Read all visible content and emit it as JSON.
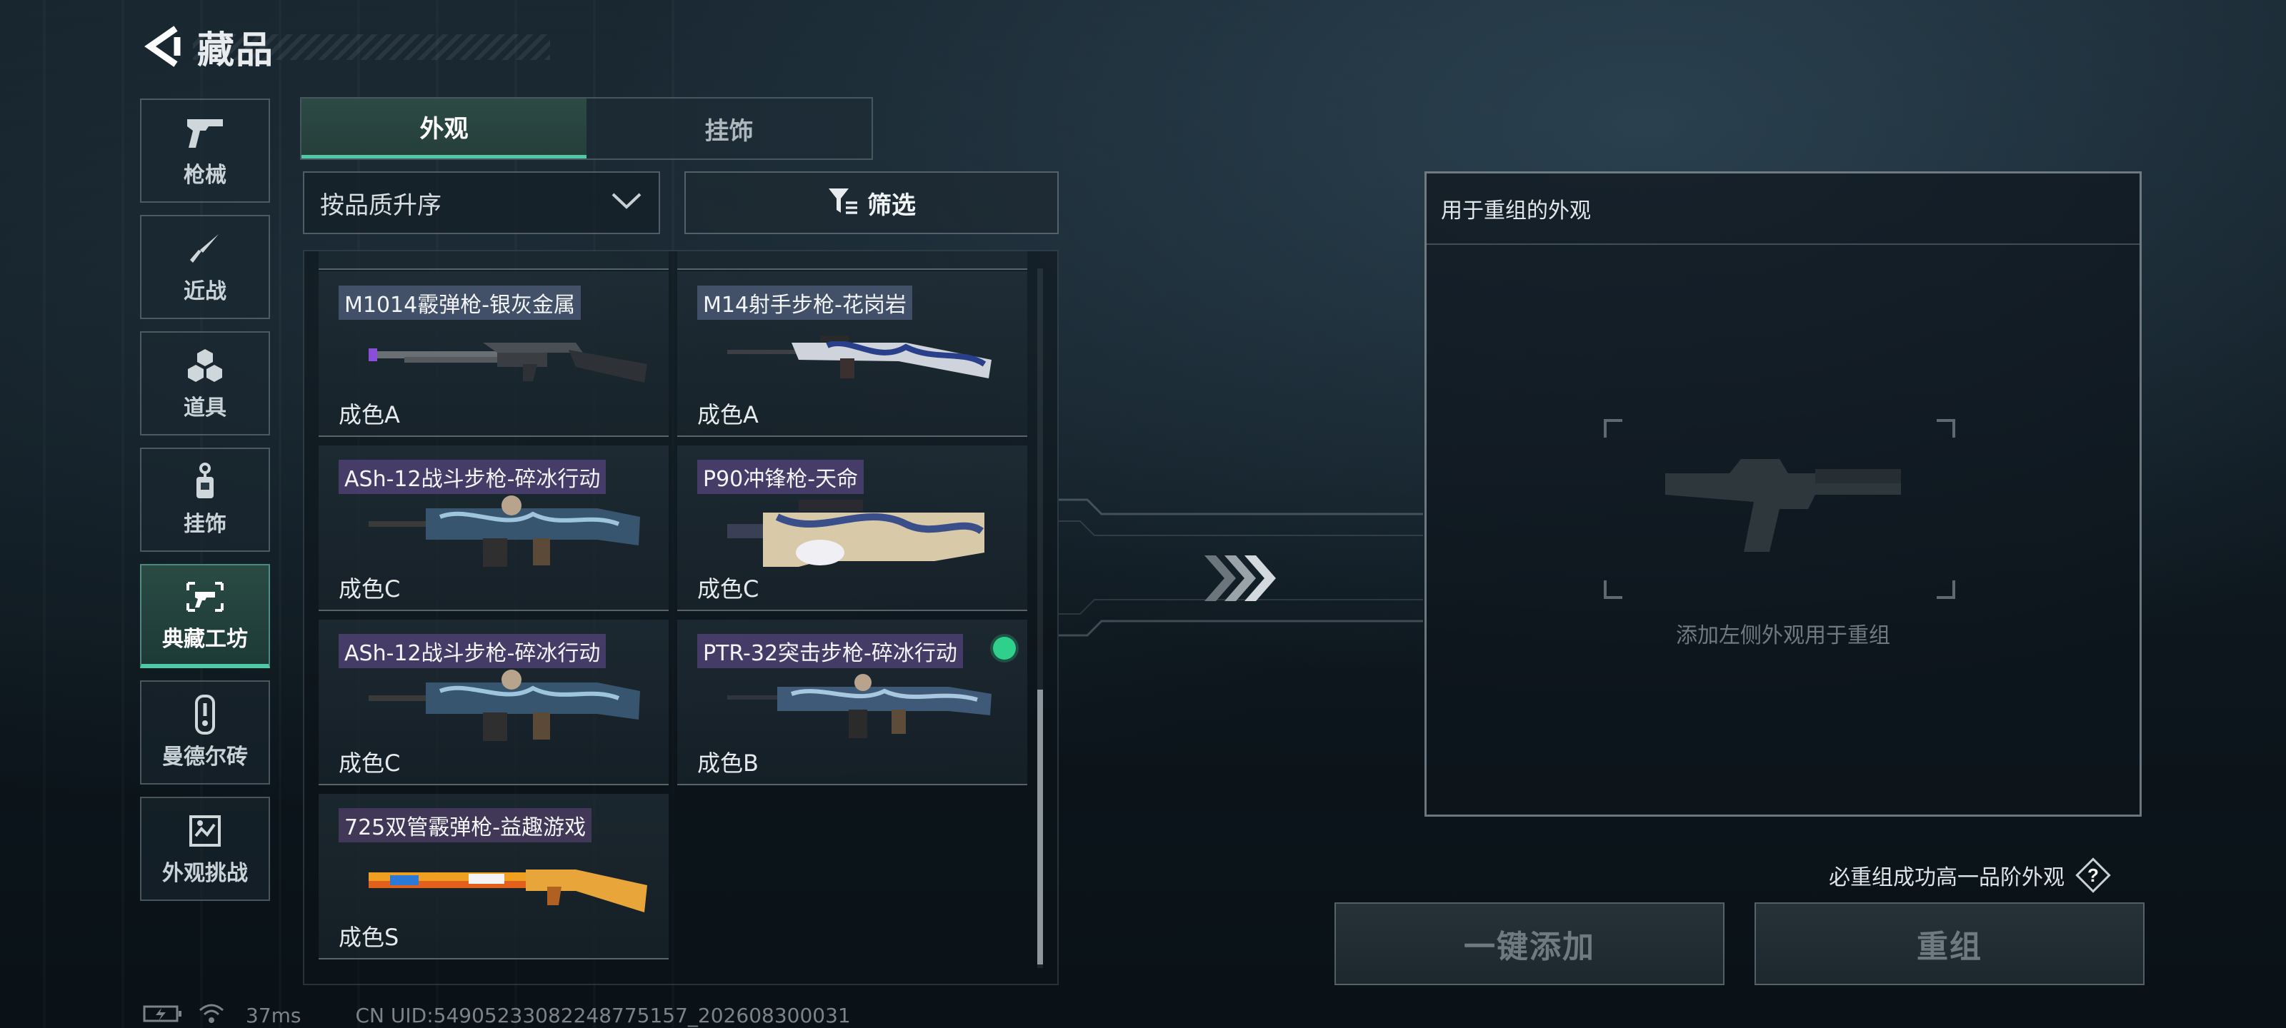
{
  "header": {
    "title": "藏品",
    "back_icon": "arrow-left-icon"
  },
  "sidenav": {
    "items": [
      {
        "label": "枪械",
        "icon": "pistol-icon",
        "active": false
      },
      {
        "label": "近战",
        "icon": "knife-icon",
        "active": false
      },
      {
        "label": "道具",
        "icon": "boxes-icon",
        "active": false
      },
      {
        "label": "挂饰",
        "icon": "charm-icon",
        "active": false
      },
      {
        "label": "典藏工坊",
        "icon": "workshop-icon",
        "active": true
      },
      {
        "label": "曼德尔砖",
        "icon": "brick-icon",
        "active": false
      },
      {
        "label": "外观挑战",
        "icon": "challenge-icon",
        "active": false
      }
    ]
  },
  "tabs": [
    {
      "label": "外观",
      "active": true
    },
    {
      "label": "挂饰",
      "active": false
    }
  ],
  "sort": {
    "label": "按品质升序",
    "icon": "chevron-down-icon"
  },
  "filter": {
    "label": "筛选",
    "icon": "filter-icon"
  },
  "grid": {
    "partial_label": "成色A",
    "items": [
      {
        "name": "M1014霰弹枪-银灰金属",
        "grade": "成色A",
        "selected": false,
        "tag": "blue"
      },
      {
        "name": "M14射手步枪-花岗岩",
        "grade": "成色A",
        "selected": false,
        "tag": "blue"
      },
      {
        "name": "ASh-12战斗步枪-碎冰行动",
        "grade": "成色C",
        "selected": false,
        "tag": "purple"
      },
      {
        "name": "P90冲锋枪-天命",
        "grade": "成色C",
        "selected": false,
        "tag": "purple"
      },
      {
        "name": "ASh-12战斗步枪-碎冰行动",
        "grade": "成色C",
        "selected": false,
        "tag": "purple"
      },
      {
        "name": "PTR-32突击步枪-碎冰行动",
        "grade": "成色B",
        "selected": true,
        "tag": "purple"
      },
      {
        "name": "725双管霰弹枪-益趣游戏",
        "grade": "成色S",
        "selected": false,
        "tag": "gold"
      }
    ]
  },
  "recombine": {
    "header": "用于重组的外观",
    "hint": "添加左侧外观用于重组",
    "guarantee": "必重组成功高一品阶外观",
    "help_icon": "question-icon",
    "add_all_label": "一键添加",
    "recombine_label": "重组"
  },
  "status": {
    "latency": "37ms",
    "uid": "CN UID:54905233082248775157_202608300031"
  },
  "colors": {
    "accent": "#4fc9a6",
    "selected": "#2fd08c"
  }
}
